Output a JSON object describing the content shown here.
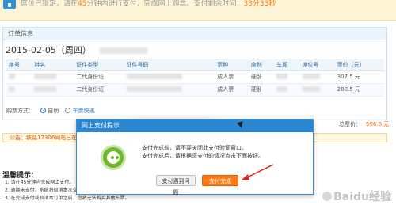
{
  "banner": {
    "text_before": "席位已锁定，请在",
    "minutes": "45",
    "text_after": "分钟内进行支付，完成网上购票。支付剩余时间：",
    "countdown": "33分33秒"
  },
  "order": {
    "panel_title": "订单信息",
    "trip_date": "2015-02-05（周四）",
    "columns": [
      "序号",
      "姓名",
      "证件类型",
      "证件号码",
      "票种",
      "席别",
      "车厢",
      "席位号",
      "票价（元）"
    ],
    "rows": [
      {
        "no": "",
        "name": "",
        "id_type": "二代身份证",
        "id_no": "",
        "ticket": "成人票",
        "seat_class": "硬卧",
        "car": "",
        "seat": "",
        "price": "307.5 元"
      },
      {
        "no": "",
        "name": "",
        "id_type": "二代身份证",
        "id_no": "",
        "ticket": "成人票",
        "seat_class": "硬卧",
        "car": "",
        "seat": "",
        "price": "288.5 元"
      }
    ]
  },
  "payment": {
    "label": "购票方式：",
    "option_self": "自助",
    "option_delivery": "车票快递"
  },
  "total": {
    "label": "总票价：",
    "amount": "596.0 元"
  },
  "notice": "公告：铁路12306网站已在北京...",
  "tips": {
    "title": "温馨提示：",
    "items": [
      "1. 请在45分钟内完成网上支付。",
      "2. 逾期未支付，系统将取消本次交易。",
      "3. 在完成支付或取消本订单之前，您将无法购买其他车票。"
    ]
  },
  "modal": {
    "title": "网上支付提示",
    "line1": "支付完成前，请不要关闭此支付验证窗口。",
    "line2": "支付完成后，请根据您支付的情况点击下面按钮。",
    "problem_button": "支付遇到问题",
    "done_button": "支付完成"
  },
  "watermark": "Baidu经验",
  "colors": {
    "accent": "#2b86d2",
    "primary_button": "#ff7a13",
    "success": "#6fb82a"
  }
}
